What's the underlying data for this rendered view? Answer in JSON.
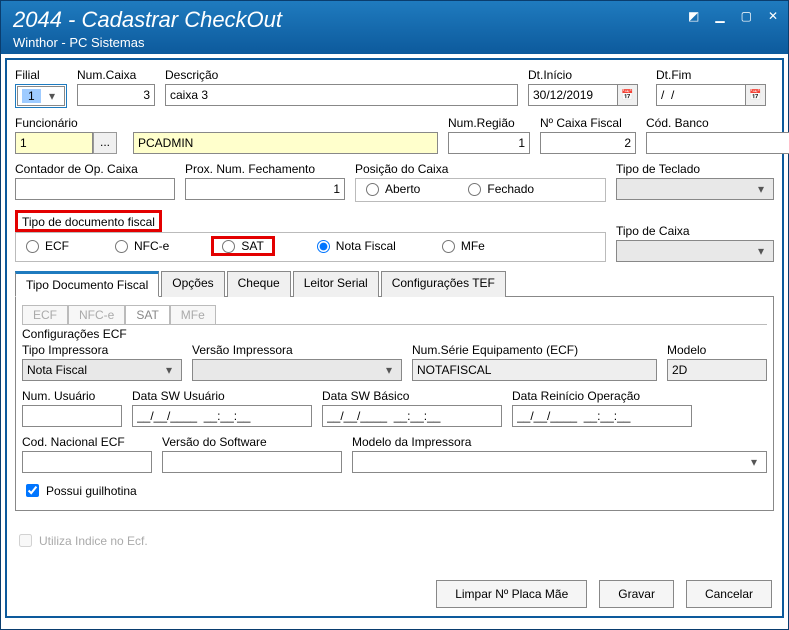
{
  "window": {
    "title": "2044 - Cadastrar CheckOut",
    "subtitle": "Winthor - PC Sistemas"
  },
  "labels": {
    "filial": "Filial",
    "num_caixa": "Num.Caixa",
    "descricao": "Descrição",
    "dt_inicio": "Dt.Início",
    "dt_fim": "Dt.Fim",
    "funcionario": "Funcionário",
    "num_regiao": "Num.Região",
    "n_caixa_fiscal": "Nº Caixa Fiscal",
    "cod_banco": "Cód. Banco",
    "contador": "Contador de Op. Caixa",
    "prox_num_fechamento": "Prox. Num. Fechamento",
    "posicao_caixa": "Posição do Caixa",
    "aberto": "Aberto",
    "fechado": "Fechado",
    "tipo_teclado": "Tipo de Teclado",
    "tipo_doc_fiscal": "Tipo de documento fiscal",
    "ecf": "ECF",
    "nfce": "NFC-e",
    "sat": "SAT",
    "nota_fiscal": "Nota Fiscal",
    "mfe": "MFe",
    "tipo_caixa": "Tipo de Caixa",
    "configuracoes_ecf": "Configurações ECF",
    "tipo_impressora": "Tipo Impressora",
    "versao_impressora": "Versão Impressora",
    "num_serie_equip": "Num.Série Equipamento (ECF)",
    "modelo": "Modelo",
    "num_usuario": "Num. Usuário",
    "data_sw_usuario": "Data  SW Usuário",
    "data_sw_basico": "Data SW Básico",
    "data_reinicio": "Data Reinício Operação",
    "cod_nacional_ecf": "Cod. Nacional ECF",
    "versao_software": "Versão do Software",
    "modelo_impressora": "Modelo da Impressora",
    "possui_guilhotina": "Possui guilhotina",
    "utiliza_indice": "Utiliza Indice no Ecf."
  },
  "values": {
    "filial": "1",
    "num_caixa": "3",
    "descricao": "caixa 3",
    "dt_inicio": "30/12/2019",
    "dt_fim": "/  /",
    "funcionario_cod": "1",
    "funcionario_nome": "PCADMIN",
    "num_regiao": "1",
    "n_caixa_fiscal": "2",
    "cod_banco": "",
    "contador": "",
    "prox_num_fechamento": "1",
    "tipo_impressora": "Nota Fiscal",
    "num_serie_equip": "NOTAFISCAL",
    "modelo": "2D",
    "date_mask": "__/__/____  __:__:__",
    "date_mask_short": "__/__/____  __:__:__"
  },
  "tabs": {
    "main": [
      "Tipo Documento Fiscal",
      "Opções",
      "Cheque",
      "Leitor Serial",
      "Configurações TEF"
    ],
    "sub": [
      "ECF",
      "NFC-e",
      "SAT",
      "MFe"
    ]
  },
  "buttons": {
    "limpar": "Limpar Nº Placa Mãe",
    "gravar": "Gravar",
    "cancelar": "Cancelar"
  }
}
